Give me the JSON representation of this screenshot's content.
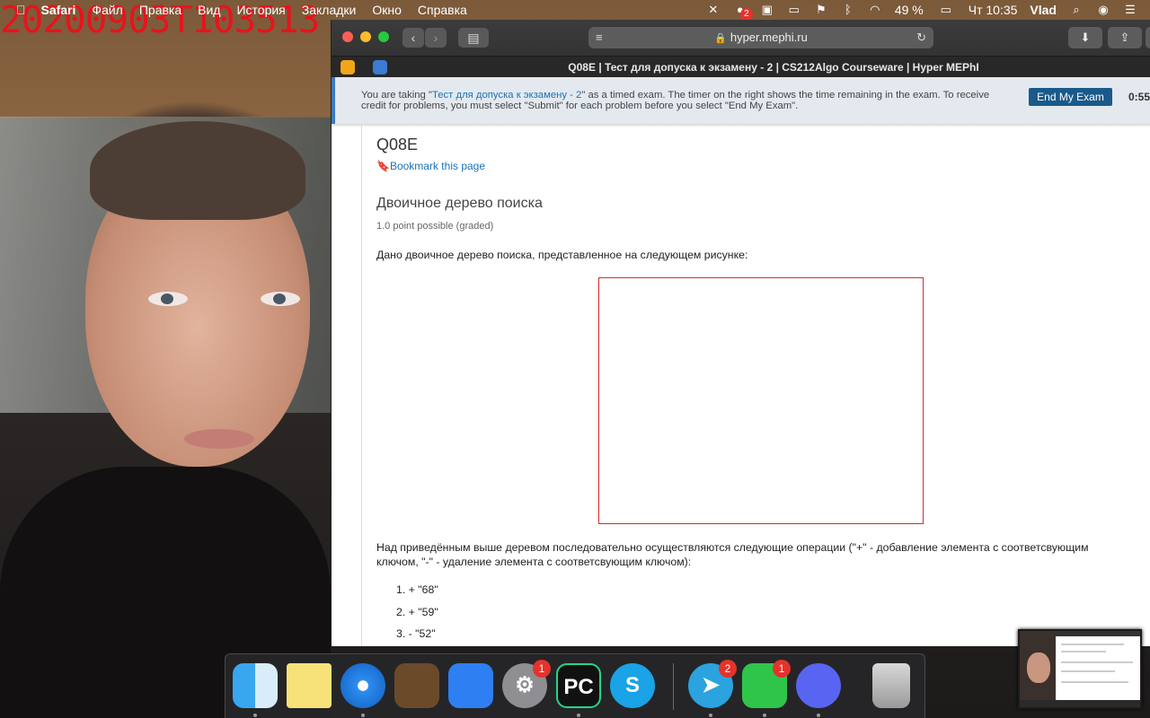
{
  "webcam": {
    "timestamp": "20200903T103513"
  },
  "menubar": {
    "app": "Safari",
    "items": [
      "Файл",
      "Правка",
      "Вид",
      "История",
      "Закладки",
      "Окно",
      "Справка"
    ],
    "status": {
      "badge": "2",
      "battery": "49 %",
      "clock": "Чт 10:35",
      "user": "Vlad"
    }
  },
  "browser": {
    "url": "hyper.mephi.ru",
    "tab_title": "Q08E | Тест для допуска к экзамену - 2 | CS212Algo Courseware | Hyper MEPhI"
  },
  "banner": {
    "text_before": "You are taking \"",
    "exam_link": "Тест для допуска к экзамену - 2",
    "text_after": "\" as a timed exam. The timer on the right shows the time remaining in the exam. To receive credit for problems, you must select \"Submit\" for each problem before you select \"End My Exam\".",
    "end_button": "End My Exam",
    "timer": "0:55:"
  },
  "content": {
    "unit_title": "Q08E",
    "bookmark": "Bookmark this page",
    "problem_title": "Двоичное дерево поиска",
    "points": "1.0 point possible (graded)",
    "intro": "Дано двоичное дерево поиска, представленное на следующем рисунке:",
    "ops_text": "Над приведённым выше деревом последовательно осуществляются следующие операции (\"+\" - добавление элемента с соответсвующим ключом, \"-\" - удаление элемента с соответсвующим ключом):",
    "operations": [
      "1.  + \"68\"",
      "2.  + \"59\"",
      "3.  - \"52\""
    ]
  },
  "dock": {
    "apps": [
      {
        "name": "Finder",
        "icon": "finder-icon"
      },
      {
        "name": "Notes",
        "icon": "notes-icon"
      },
      {
        "name": "Safari",
        "icon": "safari-icon"
      },
      {
        "name": "GarageBand",
        "icon": "garageband-icon"
      },
      {
        "name": "Xcode",
        "icon": "xcode-icon"
      },
      {
        "name": "System Preferences",
        "icon": "gear-icon",
        "badge": "1"
      },
      {
        "name": "PyCharm",
        "icon": "pycharm-icon",
        "label": "PC"
      },
      {
        "name": "Skype",
        "icon": "skype-icon",
        "label": "S"
      },
      {
        "name": "Telegram",
        "icon": "telegram-icon",
        "badge": "2"
      },
      {
        "name": "FaceTime",
        "icon": "facetime-icon",
        "badge": "1"
      },
      {
        "name": "Discord",
        "icon": "discord-icon"
      },
      {
        "name": "Trash",
        "icon": "trash-icon"
      }
    ]
  },
  "colors": {
    "accent": "#1d72b5",
    "end_button": "#1a5a8b",
    "timestamp": "#e8131b",
    "figure_border": "#d62b2b"
  }
}
